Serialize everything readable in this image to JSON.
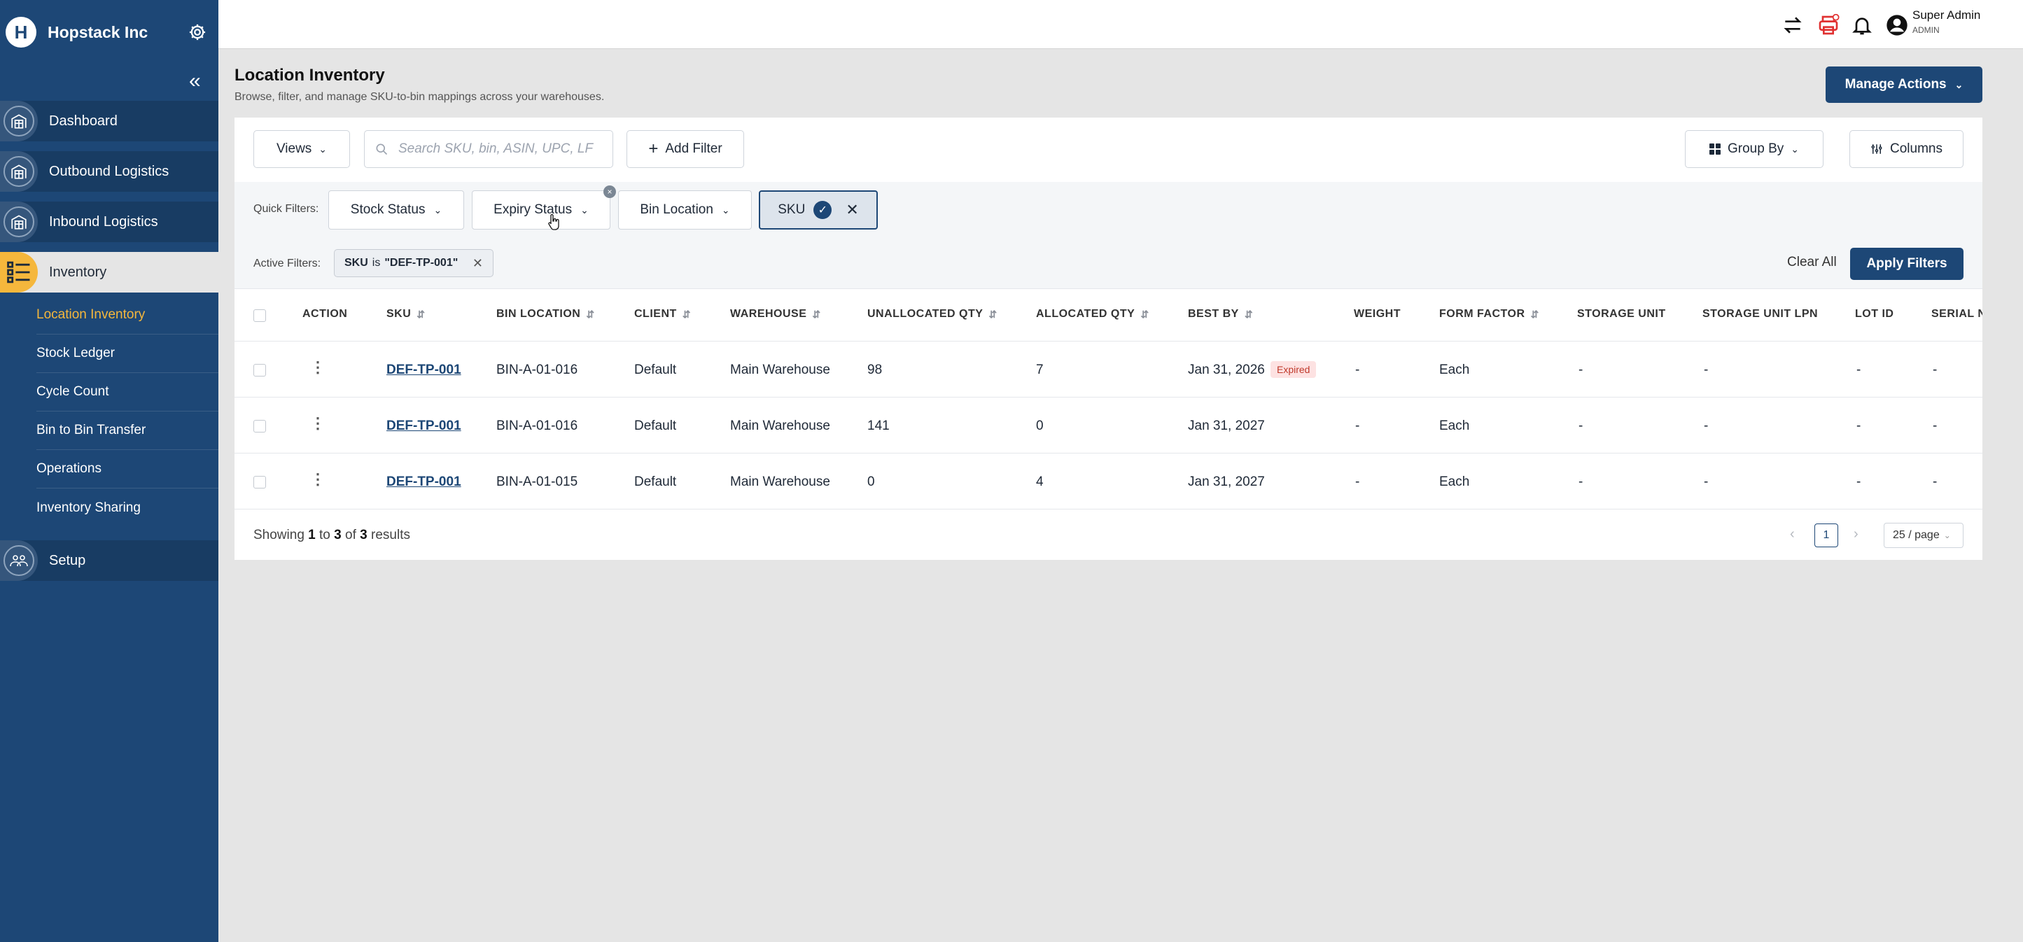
{
  "sidebar": {
    "brand_initial": "H",
    "brand_name": "Hopstack Inc",
    "collapse_glyph": "«",
    "items": [
      {
        "label": "Dashboard",
        "icon": "warehouse-icon"
      },
      {
        "label": "Outbound Logistics",
        "icon": "warehouse-icon"
      },
      {
        "label": "Inbound Logistics",
        "icon": "warehouse-icon"
      },
      {
        "label": "Inventory",
        "icon": "list-icon"
      },
      {
        "label": "Setup",
        "icon": "users-icon"
      }
    ],
    "sub_items": [
      {
        "label": "Location Inventory"
      },
      {
        "label": "Stock Ledger"
      },
      {
        "label": "Cycle Count"
      },
      {
        "label": "Bin to Bin Transfer"
      },
      {
        "label": "Operations"
      },
      {
        "label": "Inventory Sharing"
      }
    ]
  },
  "topbar": {
    "user_name": "Super Admin",
    "user_role": "ADMIN",
    "notification_count": "0"
  },
  "page": {
    "title": "Location Inventory",
    "subtitle": "Browse, filter, and manage SKU-to-bin mappings across your warehouses.",
    "manage_actions": "Manage Actions"
  },
  "toolbar": {
    "views": "Views",
    "search_placeholder": "Search SKU, bin, ASIN, UPC, LF",
    "add_filter": "Add Filter",
    "group_by": "Group By",
    "columns": "Columns"
  },
  "quick_filters": {
    "label": "Quick Filters:",
    "stock_status": "Stock Status",
    "expiry_status": "Expiry Status",
    "bin_location": "Bin Location",
    "sku": "SKU"
  },
  "active_filters": {
    "label": "Active Filters:",
    "chip_field": "SKU",
    "chip_op": "is",
    "chip_value": "\"DEF-TP-001\"",
    "clear_all": "Clear All",
    "apply": "Apply Filters"
  },
  "table": {
    "headers": [
      "ACTION",
      "SKU",
      "BIN LOCATION",
      "CLIENT",
      "WAREHOUSE",
      "UNALLOCATED QTY",
      "ALLOCATED QTY",
      "BEST BY",
      "WEIGHT",
      "FORM FACTOR",
      "STORAGE UNIT",
      "STORAGE UNIT LPN",
      "LOT ID",
      "SERIAL N"
    ],
    "rows": [
      {
        "sku": "DEF-TP-001",
        "bin": "BIN-A-01-016",
        "client": "Default",
        "warehouse": "Main Warehouse",
        "unallocated": "98",
        "allocated": "7",
        "best_by": "Jan 31, 2026",
        "badge": "Expired",
        "weight": "-",
        "form_factor": "Each",
        "storage_unit": "-",
        "storage_unit_lpn": "-",
        "lot_id": "-",
        "serial": "-"
      },
      {
        "sku": "DEF-TP-001",
        "bin": "BIN-A-01-016",
        "client": "Default",
        "warehouse": "Main Warehouse",
        "unallocated": "141",
        "allocated": "0",
        "best_by": "Jan 31, 2027",
        "weight": "-",
        "form_factor": "Each",
        "storage_unit": "-",
        "storage_unit_lpn": "-",
        "lot_id": "-",
        "serial": "-"
      },
      {
        "sku": "DEF-TP-001",
        "bin": "BIN-A-01-015",
        "client": "Default",
        "warehouse": "Main Warehouse",
        "unallocated": "0",
        "allocated": "4",
        "best_by": "Jan 31, 2027",
        "weight": "-",
        "form_factor": "Each",
        "storage_unit": "-",
        "storage_unit_lpn": "-",
        "lot_id": "-",
        "serial": "-"
      }
    ]
  },
  "footer": {
    "showing_prefix": "Showing",
    "from": "1",
    "to_word": "to",
    "to": "3",
    "of_word": "of",
    "total": "3",
    "results_word": "results",
    "page": "1",
    "per_page": "25 / page"
  },
  "colors": {
    "sidebar": "#1d4776",
    "accent": "#f5b73c",
    "primary": "#1d4776",
    "expired_bg": "#fde2e2",
    "expired_text": "#c0392b",
    "notification": "#e03131"
  }
}
